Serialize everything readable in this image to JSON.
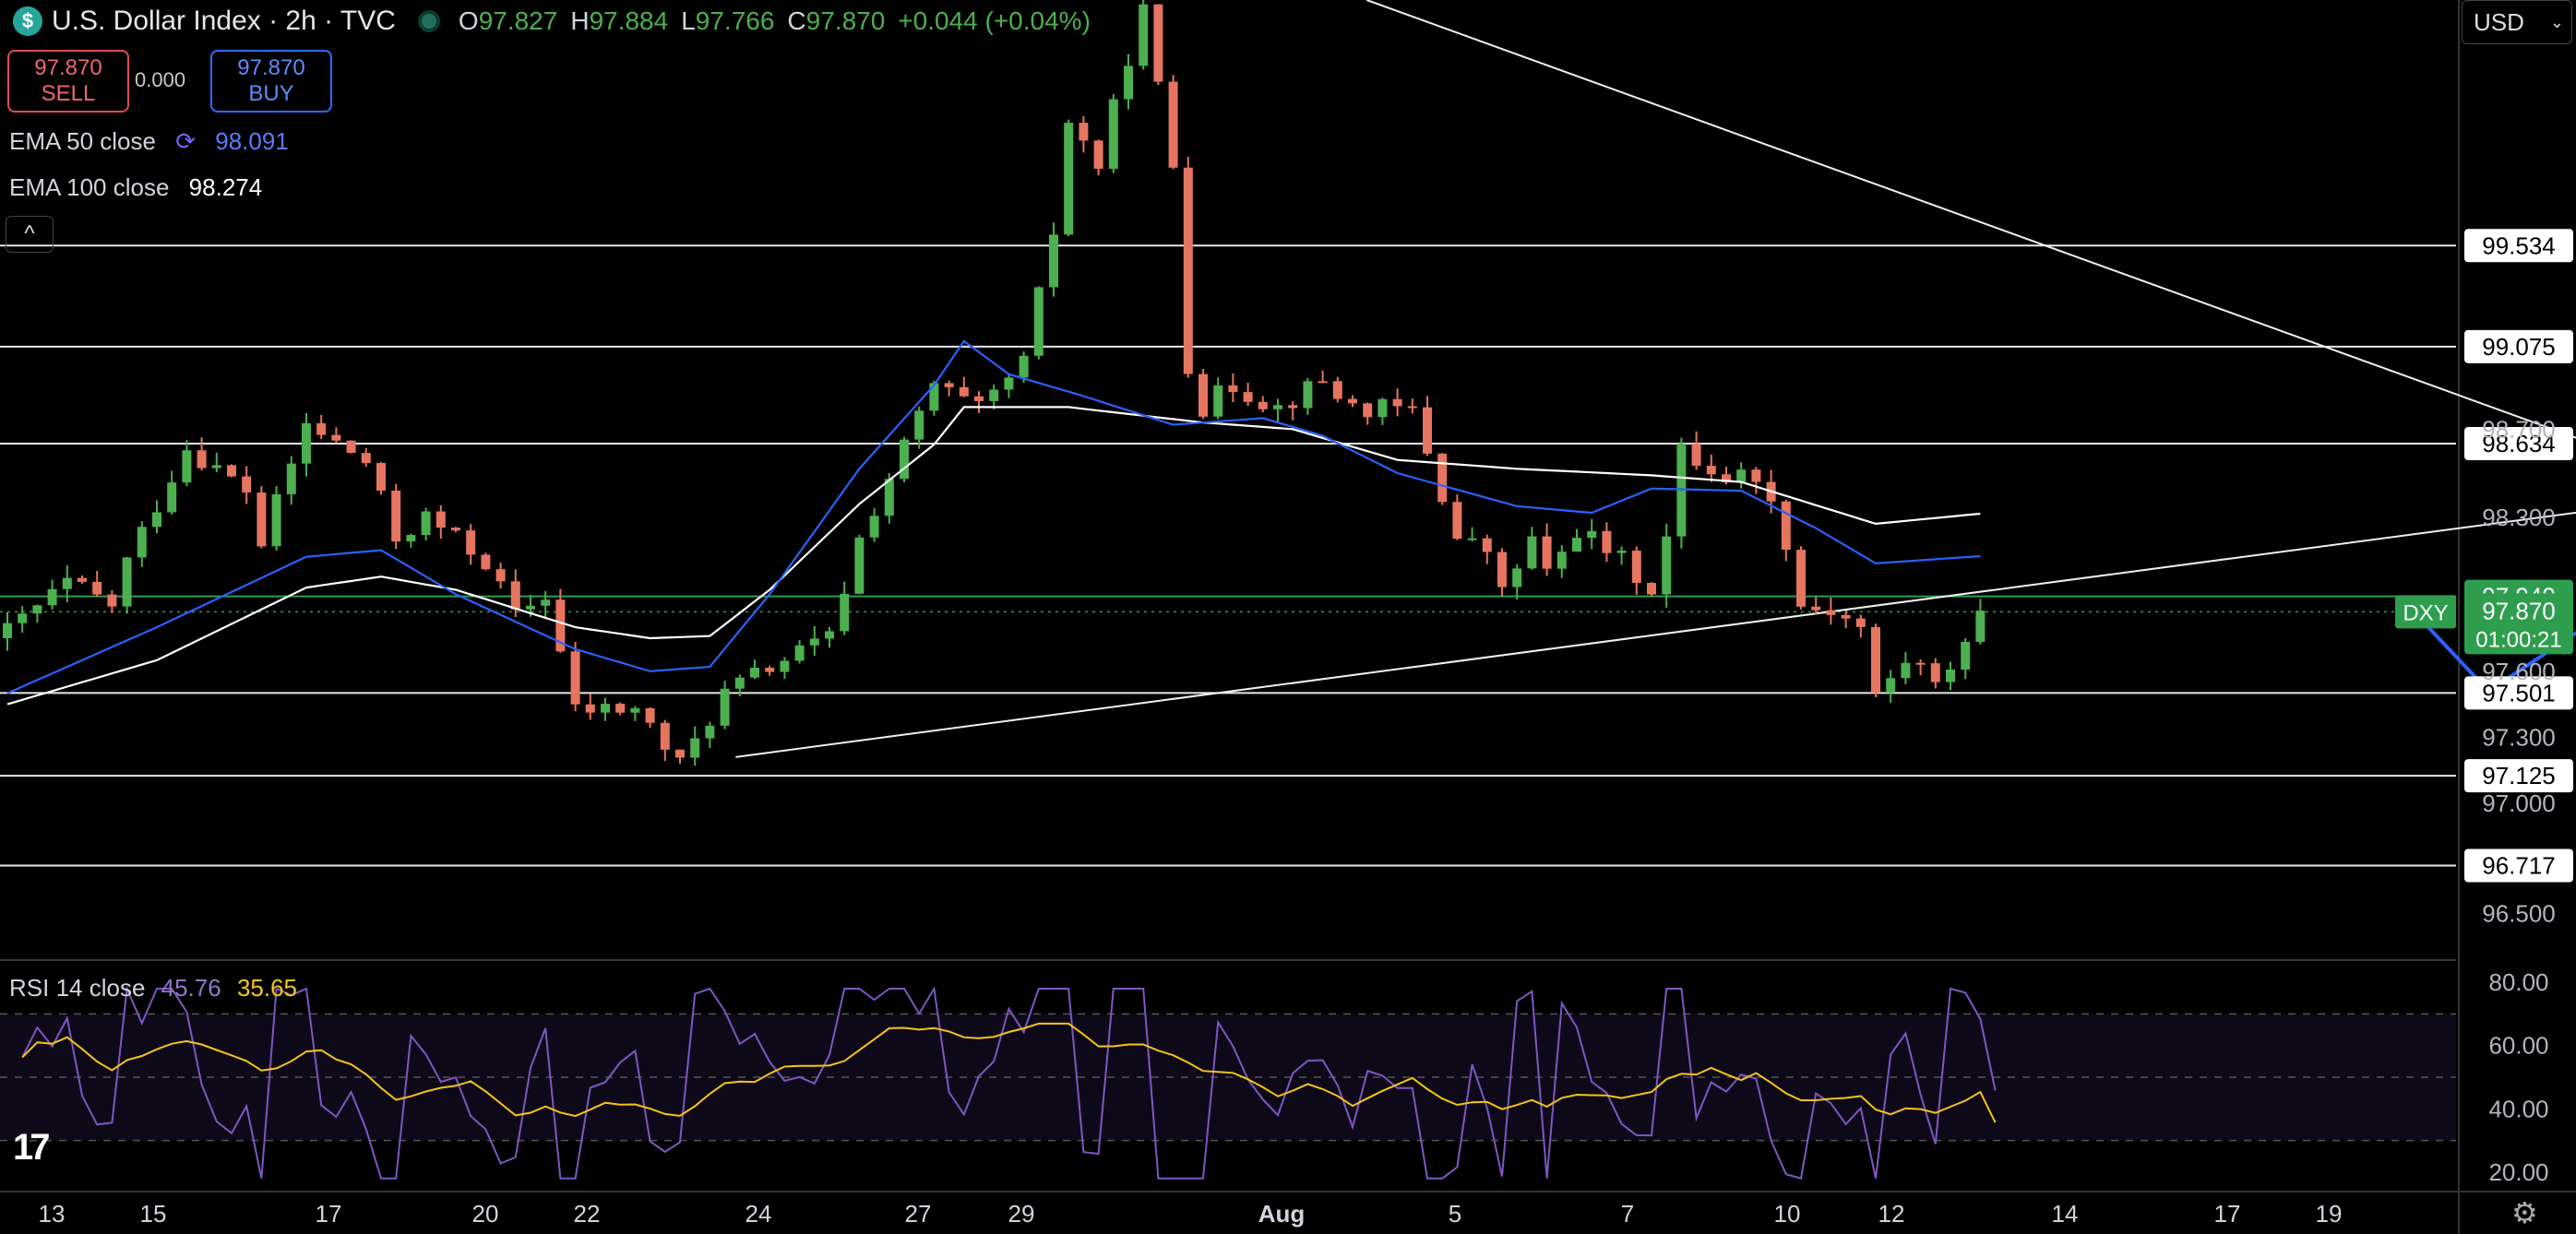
{
  "header": {
    "logo_glyph": "$",
    "title": "U.S. Dollar Index · 2h · TVC",
    "ohlc": [
      {
        "k": "O",
        "v": "97.827"
      },
      {
        "k": "H",
        "v": "97.884"
      },
      {
        "k": "L",
        "v": "97.766"
      },
      {
        "k": "C",
        "v": "97.870"
      }
    ],
    "change": "+0.044 (+0.04%)"
  },
  "trade": {
    "sell_price": "97.870",
    "sell_label": "SELL",
    "spread": "0.000",
    "buy_price": "97.870",
    "buy_label": "BUY"
  },
  "indicators": {
    "ema50_label": "EMA 50 close",
    "ema50_value": "98.091",
    "ema100_label": "EMA 100 close",
    "ema100_value": "98.274",
    "collapse_glyph": "^"
  },
  "currency": {
    "label": "USD",
    "chevron": "⌄"
  },
  "rsi": {
    "label": "RSI 14 close",
    "value1": "45.76",
    "value2": "35.65"
  },
  "colors": {
    "up": "#4caf50",
    "down": "#e57560",
    "ema50": "#2962ff",
    "ema100": "#ffffff",
    "rsi": "#7e57c2",
    "rsi_ma": "#f5c518",
    "projection": "#2962ff",
    "last_price": "#2e9e4e"
  },
  "chart_data": [
    {
      "type": "candlestick",
      "title": "U.S. Dollar Index · 2h · TVC",
      "symbol_tag": "DXY",
      "last_price": 97.87,
      "countdown": "01:00:21",
      "y_ticks": [
        98.7,
        98.3,
        97.6,
        97.3,
        97.0,
        96.5
      ],
      "ylim": [
        96.3,
        100.65
      ],
      "x_ticks": [
        "13",
        "15",
        "17",
        "20",
        "22",
        "24",
        "27",
        "29",
        "Aug",
        "5",
        "7",
        "10",
        "12",
        "14",
        "17",
        "19"
      ],
      "horizontal_levels": [
        99.534,
        99.075,
        98.634,
        97.501,
        97.125,
        96.717
      ],
      "highlighted_level": 97.94,
      "trendlines": [
        {
          "from": [
            23,
            97.21
          ],
          "to": [
            169,
            98.6
          ],
          "note": "rising support"
        },
        {
          "from": [
            63,
            100.65
          ],
          "to": [
            169,
            97.9
          ],
          "note": "falling resistance"
        }
      ],
      "projection_path": [
        [
          161,
          97.87
        ],
        [
          166,
          97.51
        ],
        [
          174,
          97.87
        ],
        [
          184,
          97.15
        ]
      ],
      "ema50_anchors": [
        [
          0,
          97.5
        ],
        [
          10,
          97.8
        ],
        [
          20,
          98.12
        ],
        [
          25,
          98.15
        ],
        [
          30,
          97.95
        ],
        [
          38,
          97.7
        ],
        [
          43,
          97.6
        ],
        [
          47,
          97.62
        ],
        [
          51,
          97.95
        ],
        [
          57,
          98.52
        ],
        [
          62,
          98.9
        ],
        [
          64,
          99.1
        ],
        [
          67,
          98.95
        ],
        [
          72,
          98.85
        ],
        [
          78,
          98.72
        ],
        [
          84,
          98.75
        ],
        [
          88,
          98.67
        ],
        [
          93,
          98.5
        ],
        [
          101,
          98.35
        ],
        [
          106,
          98.32
        ],
        [
          110,
          98.43
        ],
        [
          116,
          98.42
        ],
        [
          121,
          98.25
        ],
        [
          125,
          98.09
        ]
      ],
      "ema100_anchors": [
        [
          0,
          97.45
        ],
        [
          10,
          97.65
        ],
        [
          20,
          97.98
        ],
        [
          25,
          98.03
        ],
        [
          30,
          97.97
        ],
        [
          38,
          97.8
        ],
        [
          43,
          97.75
        ],
        [
          47,
          97.76
        ],
        [
          51,
          97.97
        ],
        [
          57,
          98.36
        ],
        [
          62,
          98.63
        ],
        [
          64,
          98.8
        ],
        [
          71,
          98.8
        ],
        [
          80,
          98.73
        ],
        [
          86,
          98.7
        ],
        [
          93,
          98.56
        ],
        [
          101,
          98.52
        ],
        [
          110,
          98.49
        ],
        [
          116,
          98.46
        ],
        [
          125,
          98.27
        ]
      ],
      "close_anchors": [
        [
          0,
          97.78
        ],
        [
          4,
          98.0
        ],
        [
          7,
          97.9
        ],
        [
          8,
          98.1
        ],
        [
          12,
          98.62
        ],
        [
          16,
          98.42
        ],
        [
          17,
          98.18
        ],
        [
          20,
          98.72
        ],
        [
          24,
          98.55
        ],
        [
          26,
          98.2
        ],
        [
          28,
          98.3
        ],
        [
          32,
          98.1
        ],
        [
          34,
          97.85
        ],
        [
          36,
          97.95
        ],
        [
          38,
          97.42
        ],
        [
          42,
          97.43
        ],
        [
          45,
          97.17
        ],
        [
          48,
          97.5
        ],
        [
          51,
          97.62
        ],
        [
          55,
          97.75
        ],
        [
          57,
          98.2
        ],
        [
          60,
          98.62
        ],
        [
          62,
          98.9
        ],
        [
          65,
          98.78
        ],
        [
          68,
          99.0
        ],
        [
          70,
          99.6
        ],
        [
          71,
          100.1
        ],
        [
          73,
          99.9
        ],
        [
          75,
          100.4
        ],
        [
          76,
          100.6
        ],
        [
          78,
          99.9
        ],
        [
          79,
          99.0
        ],
        [
          80,
          98.8
        ],
        [
          82,
          98.9
        ],
        [
          85,
          98.8
        ],
        [
          88,
          98.92
        ],
        [
          90,
          98.8
        ],
        [
          94,
          98.78
        ],
        [
          95,
          98.6
        ],
        [
          97,
          98.2
        ],
        [
          99,
          98.15
        ],
        [
          100,
          97.95
        ],
        [
          102,
          98.2
        ],
        [
          103,
          98.03
        ],
        [
          105,
          98.25
        ],
        [
          107,
          98.15
        ],
        [
          108,
          98.1
        ],
        [
          110,
          97.98
        ],
        [
          111,
          98.2
        ],
        [
          112,
          98.6
        ],
        [
          114,
          98.52
        ],
        [
          115,
          98.48
        ],
        [
          117,
          98.5
        ],
        [
          119,
          98.2
        ],
        [
          120,
          97.9
        ],
        [
          122,
          97.88
        ],
        [
          124,
          97.8
        ],
        [
          125,
          97.48
        ],
        [
          127,
          97.65
        ],
        [
          128,
          97.62
        ],
        [
          129,
          97.52
        ],
        [
          131,
          97.75
        ],
        [
          132,
          97.87
        ]
      ],
      "rsi": {
        "ylim": [
          15,
          85
        ],
        "y_ticks": [
          80.0,
          60.0,
          40.0,
          20.0
        ],
        "bands": [
          70,
          50,
          30
        ],
        "rsi_last": 45.76,
        "ma_last": 35.65
      }
    }
  ]
}
